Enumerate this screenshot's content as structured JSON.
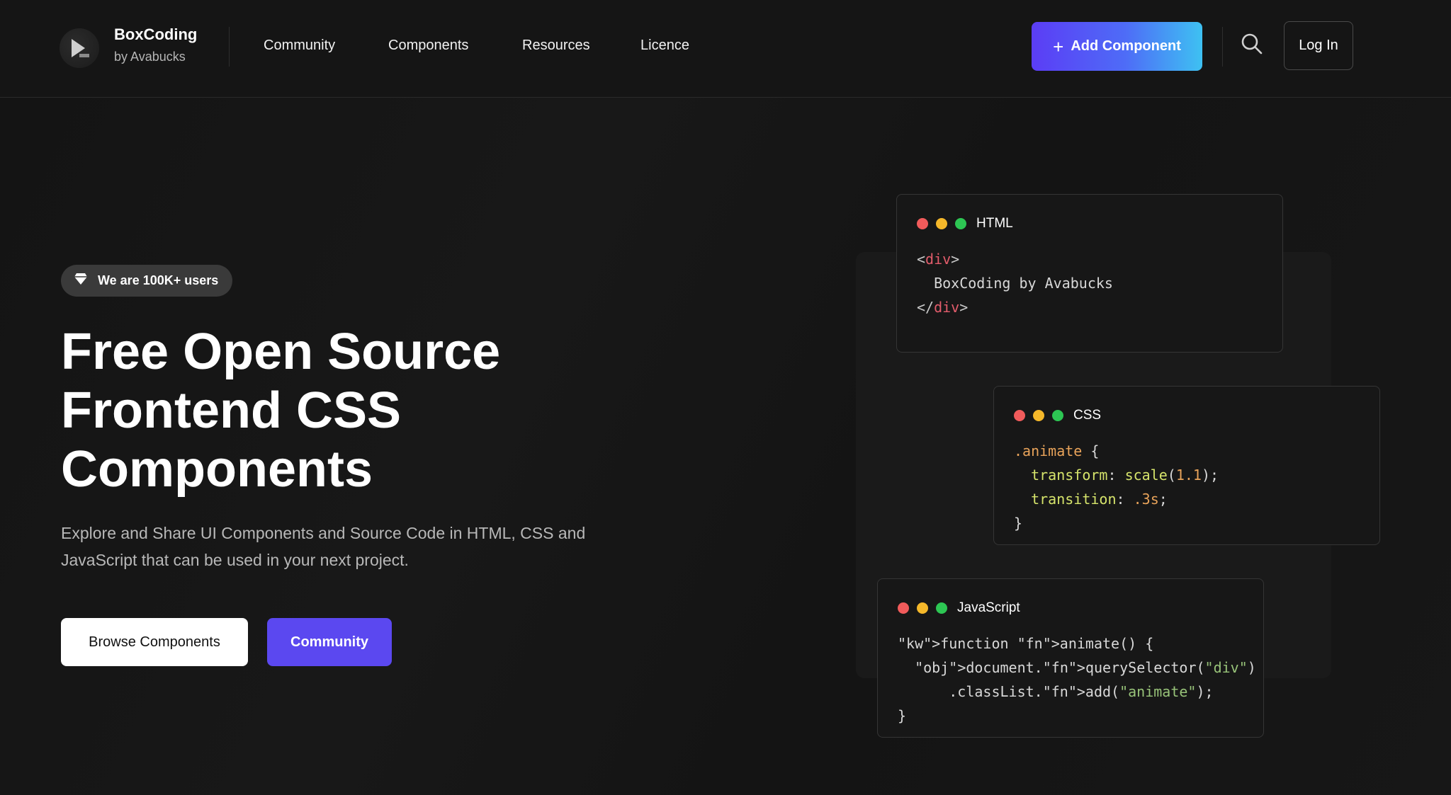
{
  "brand": {
    "name": "BoxCoding",
    "subtitle": "by Avabucks"
  },
  "nav": {
    "items": [
      "Community",
      "Components",
      "Resources",
      "Licence"
    ]
  },
  "header": {
    "add_component_label": "Add Component",
    "login_label": "Log In"
  },
  "hero": {
    "badge_text": "We are 100K+ users",
    "title_lines": [
      "Free Open Source",
      "Frontend CSS",
      "Components"
    ],
    "description": "Explore and Share UI Components and Source Code in HTML, CSS and JavaScript that can be used in your next project.",
    "browse_label": "Browse Components",
    "community_label": "Community"
  },
  "cards": {
    "html": {
      "title": "HTML",
      "lines": [
        "<div>",
        "  BoxCoding by Avabucks",
        "</div>"
      ]
    },
    "css": {
      "title": "CSS",
      "lines": [
        ".animate {",
        "  transform: scale(1.1);",
        "  transition: .3s;",
        "}"
      ]
    },
    "js": {
      "title": "JavaScript",
      "lines": [
        "function animate() {",
        "  document.querySelector(\"div\")",
        "      .classList.add(\"animate\");",
        "}"
      ]
    }
  },
  "colors": {
    "accent": "#5b48f0",
    "gradient_end": "#3ec1f2",
    "background": "#141414"
  }
}
